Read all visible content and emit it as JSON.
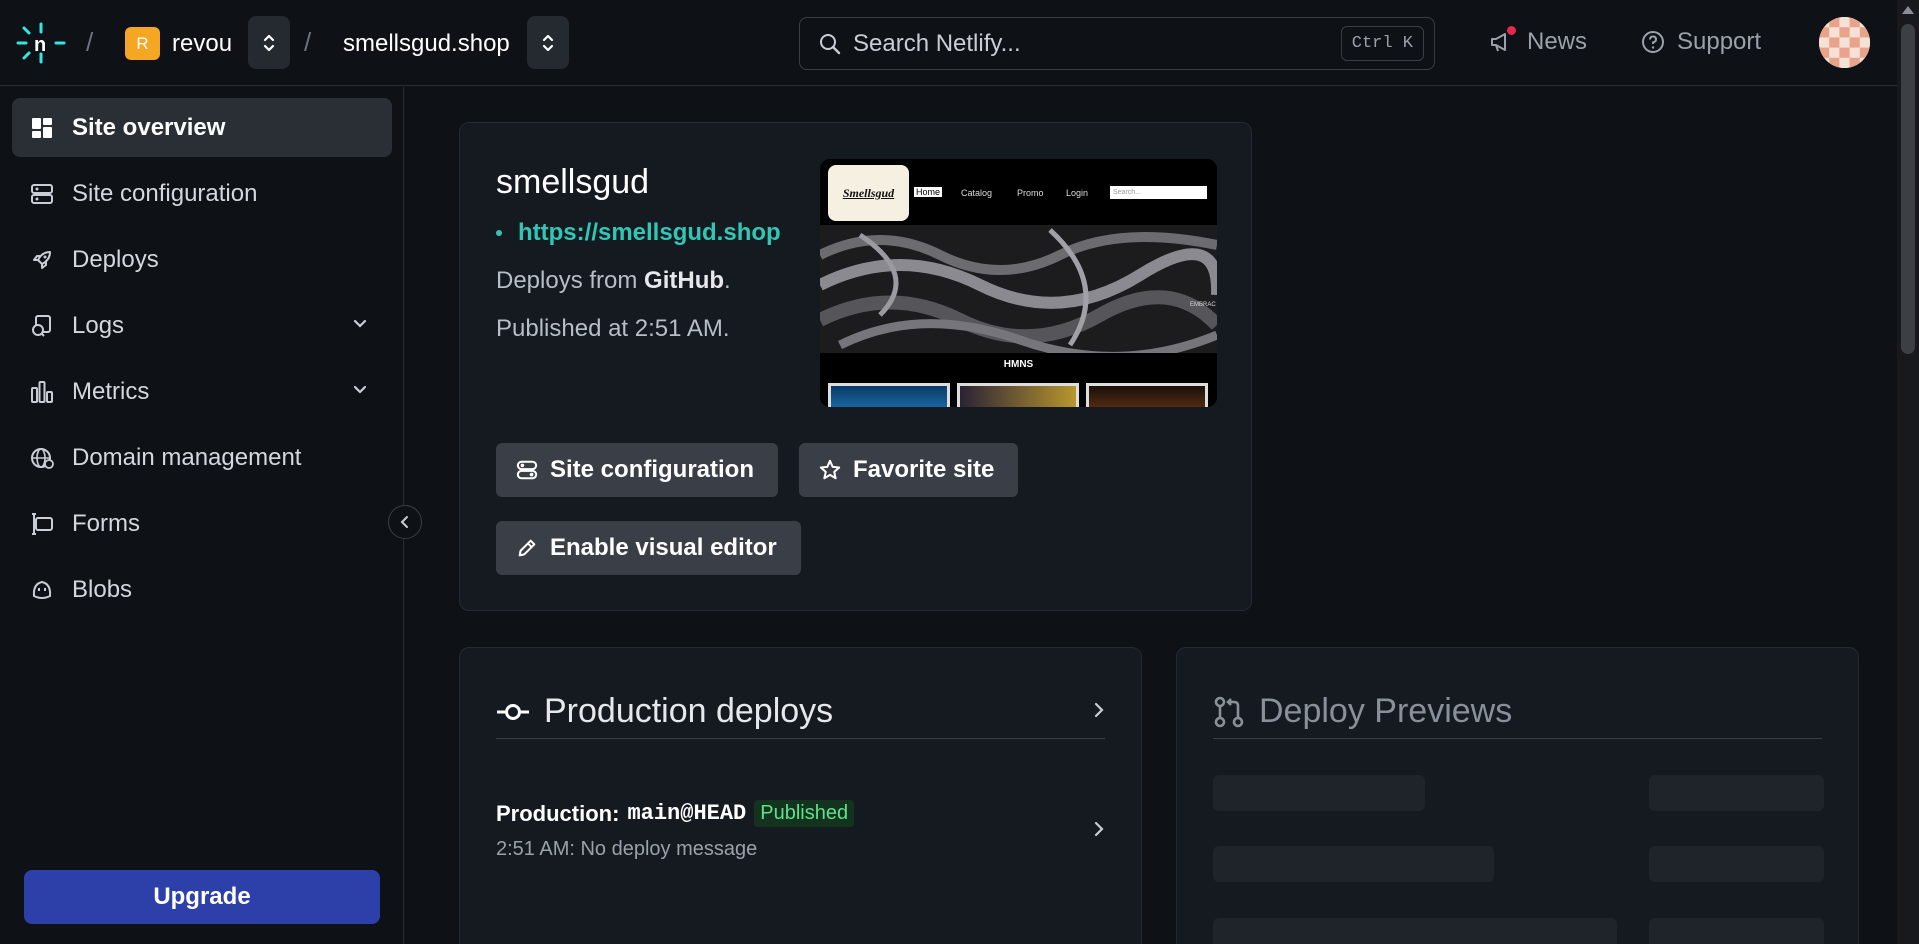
{
  "header": {
    "team_initial": "R",
    "team_name": "revou",
    "separator": "/",
    "site_name": "smellsgud.shop",
    "search_placeholder": "Search Netlify...",
    "search_shortcut": "Ctrl K",
    "news_label": "News",
    "support_label": "Support"
  },
  "sidebar": {
    "items": [
      {
        "label": "Site overview",
        "icon": "grid-icon"
      },
      {
        "label": "Site configuration",
        "icon": "config-icon"
      },
      {
        "label": "Deploys",
        "icon": "rocket-icon"
      },
      {
        "label": "Logs",
        "icon": "logs-icon"
      },
      {
        "label": "Metrics",
        "icon": "bar-chart-icon"
      },
      {
        "label": "Domain management",
        "icon": "globe-icon"
      },
      {
        "label": "Forms",
        "icon": "forms-icon"
      },
      {
        "label": "Blobs",
        "icon": "blob-icon"
      }
    ],
    "upgrade_label": "Upgrade"
  },
  "site_card": {
    "title": "smellsgud",
    "url": "https://smellsgud.shop",
    "deploys_from_prefix": "Deploys from ",
    "deploys_from_source": "GitHub",
    "deploys_from_suffix": ".",
    "published": "Published at 2:51 AM.",
    "buttons": {
      "site_config": "Site configuration",
      "favorite": "Favorite site",
      "visual_editor": "Enable visual editor"
    },
    "preview": {
      "brand": "Smellsgud",
      "nav": [
        "Home",
        "Catalog",
        "Promo",
        "Login"
      ],
      "search_placeholder": "Search...",
      "section_label": "HMNS",
      "side_text": "EMBRAC"
    }
  },
  "production_deploys": {
    "title": "Production deploys",
    "row_prefix": "Production:",
    "branch": "main@HEAD",
    "status": "Published",
    "message": "2:51 AM: No deploy message"
  },
  "deploy_previews": {
    "title": "Deploy Previews"
  },
  "colors": {
    "accent_teal": "#32c6b4",
    "upgrade_blue": "#2d3fa8",
    "published_green": "#5fe08a",
    "team_orange": "#f5a623"
  }
}
